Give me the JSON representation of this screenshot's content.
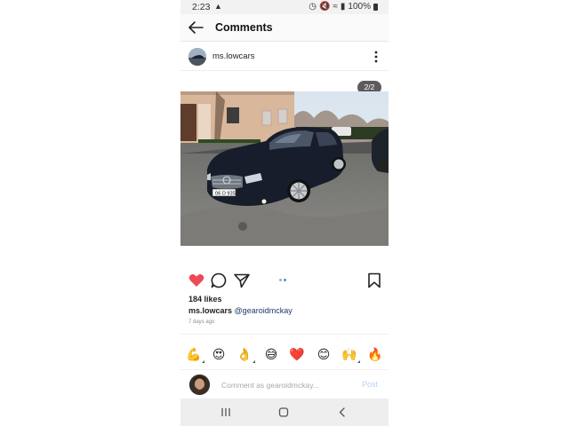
{
  "status_bar": {
    "time": "2:23",
    "battery": "100%"
  },
  "header": {
    "title": "Comments"
  },
  "post": {
    "username": "ms.lowcars",
    "page_counter": "2/2",
    "likes": "184 likes",
    "caption_user": "ms.lowcars",
    "caption_text": "@gearoidmckay",
    "time_ago": "7 days ago",
    "carousel": {
      "count": 2,
      "active_index": 1
    }
  },
  "emojis": [
    {
      "name": "flexed-biceps-emoji",
      "glyph": "💪"
    },
    {
      "name": "heart-eyes-emoji",
      "glyph": "😍"
    },
    {
      "name": "ok-hand-emoji",
      "glyph": "👌"
    },
    {
      "name": "grinning-sweat-emoji",
      "glyph": "😅"
    },
    {
      "name": "red-heart-emoji",
      "glyph": "❤️"
    },
    {
      "name": "smiling-blush-emoji",
      "glyph": "😊"
    },
    {
      "name": "raising-hands-emoji",
      "glyph": "🙌"
    },
    {
      "name": "fire-emoji",
      "glyph": "🔥"
    }
  ],
  "comment_box": {
    "placeholder": "Comment as gearoidmckay...",
    "post_label": "Post"
  },
  "colors": {
    "like": "#ed4956",
    "carousel_active": "#3897f0",
    "post_button_disabled": "#b3d4f5"
  }
}
